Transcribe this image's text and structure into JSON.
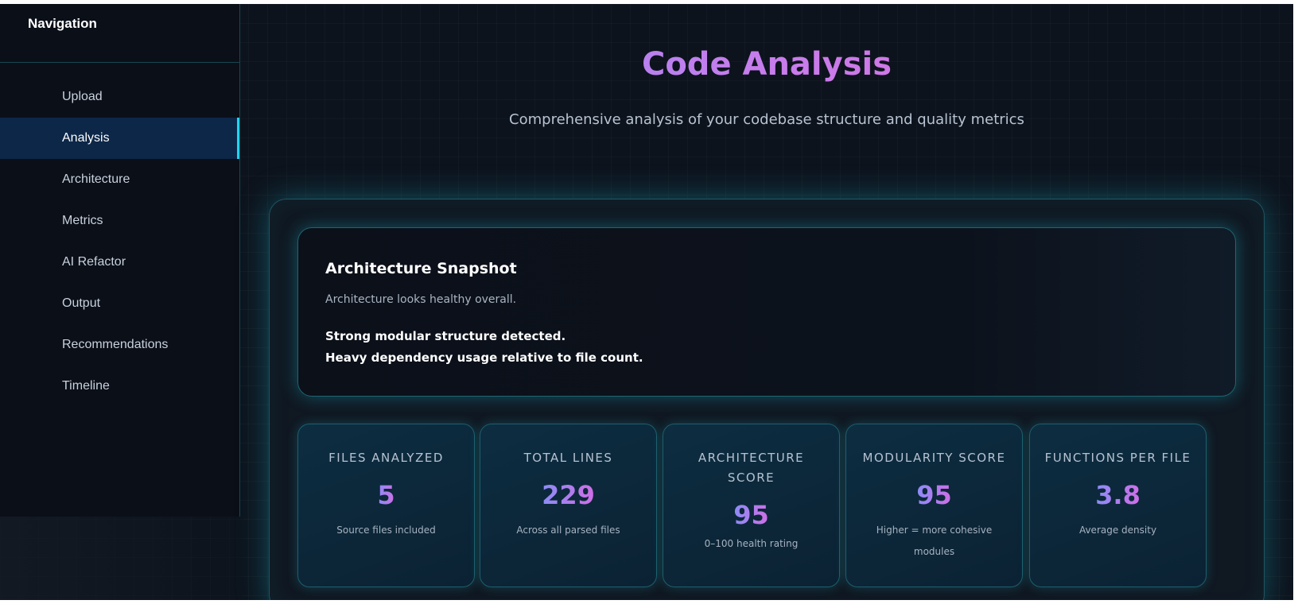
{
  "sidebar": {
    "title": "Navigation",
    "items": [
      {
        "label": "Upload",
        "active": false
      },
      {
        "label": "Analysis",
        "active": true
      },
      {
        "label": "Architecture",
        "active": false
      },
      {
        "label": "Metrics",
        "active": false
      },
      {
        "label": "AI Refactor",
        "active": false
      },
      {
        "label": "Output",
        "active": false
      },
      {
        "label": "Recommendations",
        "active": false
      },
      {
        "label": "Timeline",
        "active": false
      }
    ]
  },
  "header": {
    "title": "Code Analysis",
    "subtitle": "Comprehensive analysis of your codebase structure and quality metrics"
  },
  "snapshot": {
    "title": "Architecture Snapshot",
    "summary": "Architecture looks healthy overall.",
    "findings": [
      "Strong modular structure detected.",
      "Heavy dependency usage relative to file count."
    ]
  },
  "metrics": [
    {
      "label": "FILES ANALYZED",
      "value": "5",
      "sub": "Source files included"
    },
    {
      "label": "TOTAL LINES",
      "value": "229",
      "sub": "Across all parsed files"
    },
    {
      "label": "ARCHITECTURE SCORE",
      "value": "95",
      "sub": "0–100 health rating"
    },
    {
      "label": "MODULARITY SCORE",
      "value": "95",
      "sub": "Higher = more cohesive modules"
    },
    {
      "label": "FUNCTIONS PER FILE",
      "value": "3.8",
      "sub": "Average density"
    }
  ],
  "colors": {
    "accent": "#1fd4ef",
    "gradient_start": "#8b8cf6",
    "gradient_end": "#e56ad3",
    "background": "#0d131d"
  }
}
